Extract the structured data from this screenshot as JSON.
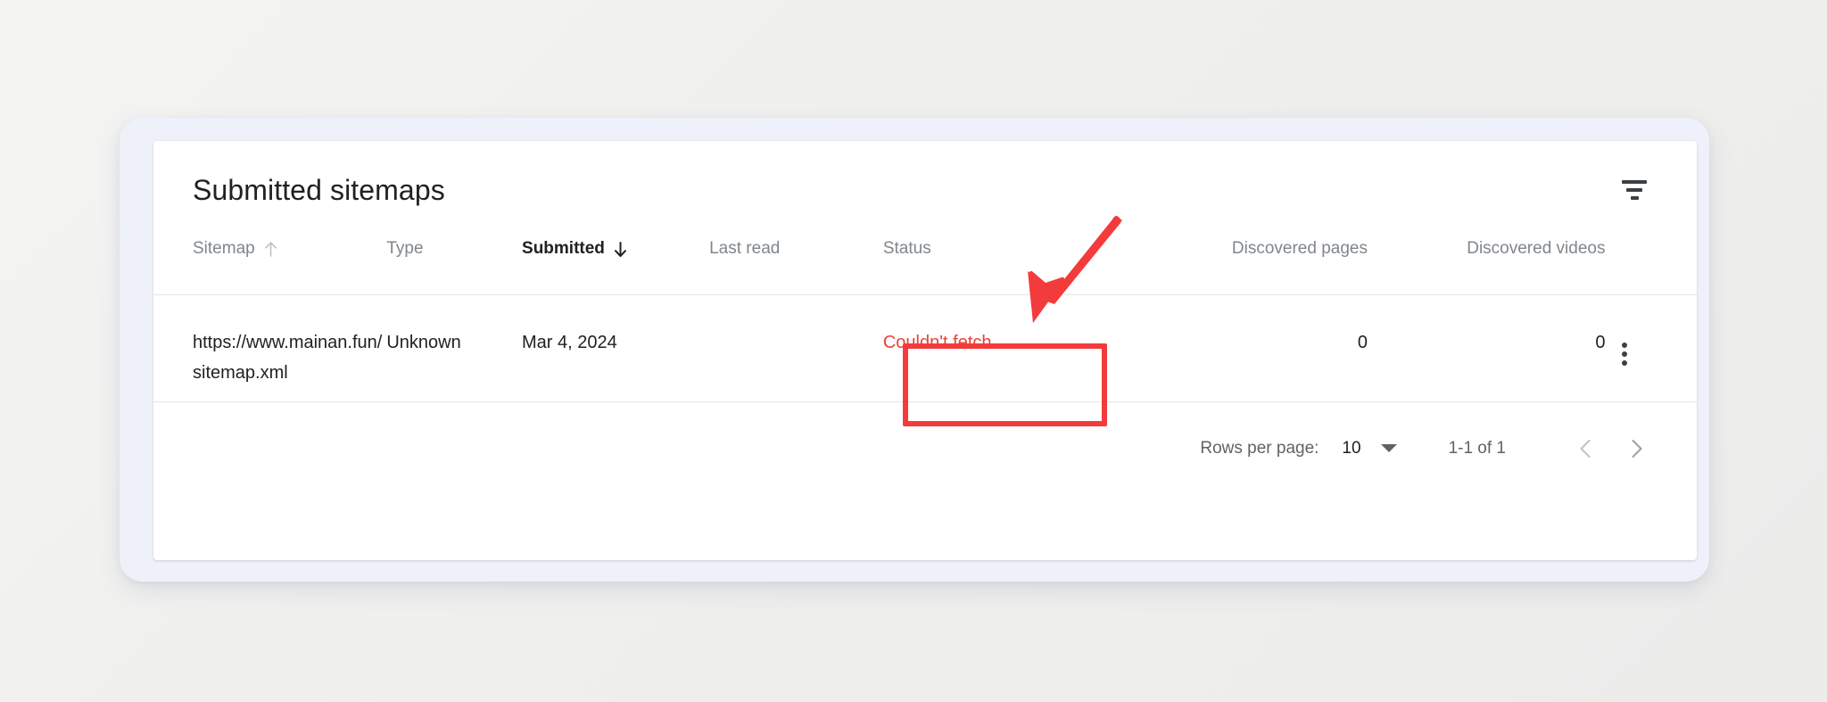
{
  "card": {
    "title": "Submitted sitemaps",
    "filter_icon": "filter-icon"
  },
  "table": {
    "columns": [
      {
        "key": "sitemap",
        "label": "Sitemap",
        "sort": "asc",
        "active": false,
        "align": "left"
      },
      {
        "key": "type",
        "label": "Type",
        "sort": "none",
        "active": false,
        "align": "left"
      },
      {
        "key": "submitted",
        "label": "Submitted",
        "sort": "desc",
        "active": true,
        "align": "left"
      },
      {
        "key": "lastread",
        "label": "Last read",
        "sort": "none",
        "active": false,
        "align": "left"
      },
      {
        "key": "status",
        "label": "Status",
        "sort": "none",
        "active": false,
        "align": "left"
      },
      {
        "key": "pages",
        "label": "Discovered pages",
        "sort": "none",
        "active": false,
        "align": "right"
      },
      {
        "key": "videos",
        "label": "Discovered videos",
        "sort": "none",
        "active": false,
        "align": "right"
      }
    ],
    "rows": [
      {
        "sitemap": "https://www.mainan.fun/sitemap.xml",
        "type": "Unknown",
        "submitted": "Mar 4, 2024",
        "lastread": "",
        "status": "Couldn't fetch",
        "status_color": "#ea4335",
        "pages": "0",
        "videos": "0",
        "menu_icon": "more-vert-icon"
      }
    ]
  },
  "pagination": {
    "rows_per_page_label": "Rows per page:",
    "rows_per_page_value": "10",
    "range_label": "1-1 of 1",
    "prev_icon": "chevron-left-icon",
    "next_icon": "chevron-right-icon"
  },
  "annotations": {
    "highlight_color": "#f33b3b",
    "arrow_icon": "arrow-pointer-icon",
    "box_target": "Couldn't fetch"
  }
}
